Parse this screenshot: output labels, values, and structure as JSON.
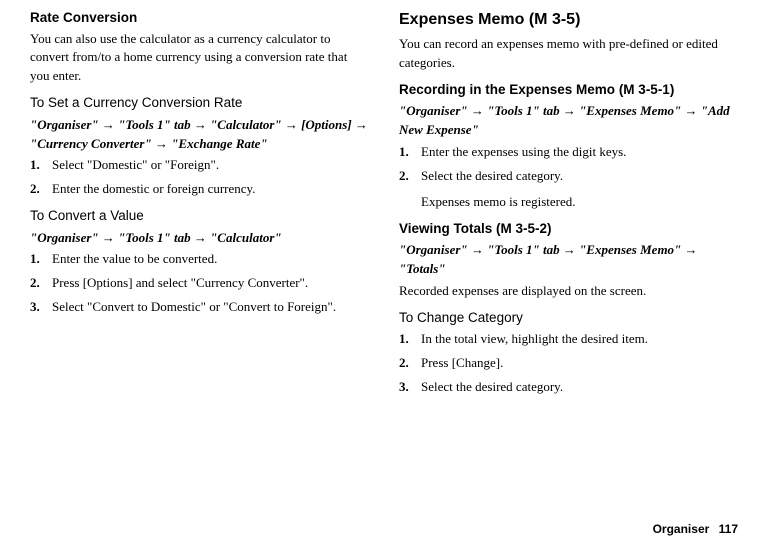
{
  "left": {
    "section_title": "Rate Conversion",
    "intro": "You can also use the calculator as a currency calculator to convert from/to a home currency using a conversion rate that you enter.",
    "sub1_heading": "To Set a Currency Conversion Rate",
    "sub1_nav_parts": [
      "\"Organiser\"",
      " → ",
      "\"Tools 1\" tab",
      " → ",
      "\"Calculator\"",
      " → ",
      "[Options]",
      " → ",
      "\"Currency Converter\"",
      " → ",
      "\"Exchange Rate\""
    ],
    "sub1_steps": [
      "Select \"Domestic\" or \"Foreign\".",
      "Enter the domestic or foreign currency."
    ],
    "sub2_heading": "To Convert a Value",
    "sub2_nav_parts": [
      "\"Organiser\"",
      " → ",
      "\"Tools 1\" tab",
      " → ",
      "\"Calculator\""
    ],
    "sub2_steps": [
      "Enter the value to be converted.",
      "Press [Options] and select \"Currency Converter\".",
      "Select \"Convert to Domestic\" or \"Convert to Foreign\"."
    ]
  },
  "right": {
    "big_heading": "Expenses Memo",
    "big_heading_ref": "(M 3-5)",
    "intro": "You can record an expenses memo with pre-defined or edited categories.",
    "sub1_heading": "Recording in the Expenses Memo",
    "sub1_ref": "(M 3-5-1)",
    "sub1_nav_parts": [
      "\"Organiser\"",
      " → ",
      "\"Tools 1\" tab",
      " → ",
      "\"Expenses Memo\"",
      " → ",
      "\"Add New Expense\""
    ],
    "sub1_steps": [
      "Enter the expenses using the digit keys.",
      "Select the desired category."
    ],
    "sub1_note": "Expenses memo is registered.",
    "sub2_heading": "Viewing Totals",
    "sub2_ref": "(M 3-5-2)",
    "sub2_nav_parts": [
      "\"Organiser\"",
      " → ",
      "\"Tools 1\" tab",
      " → ",
      "\"Expenses Memo\"",
      " → ",
      "\"Totals\""
    ],
    "sub2_text": "Recorded expenses are displayed on the screen.",
    "sub3_heading": "To Change Category",
    "sub3_steps": [
      "In the total view, highlight the desired item.",
      "Press [Change].",
      "Select the desired category."
    ]
  },
  "footer": {
    "label": "Organiser",
    "page": "117"
  }
}
